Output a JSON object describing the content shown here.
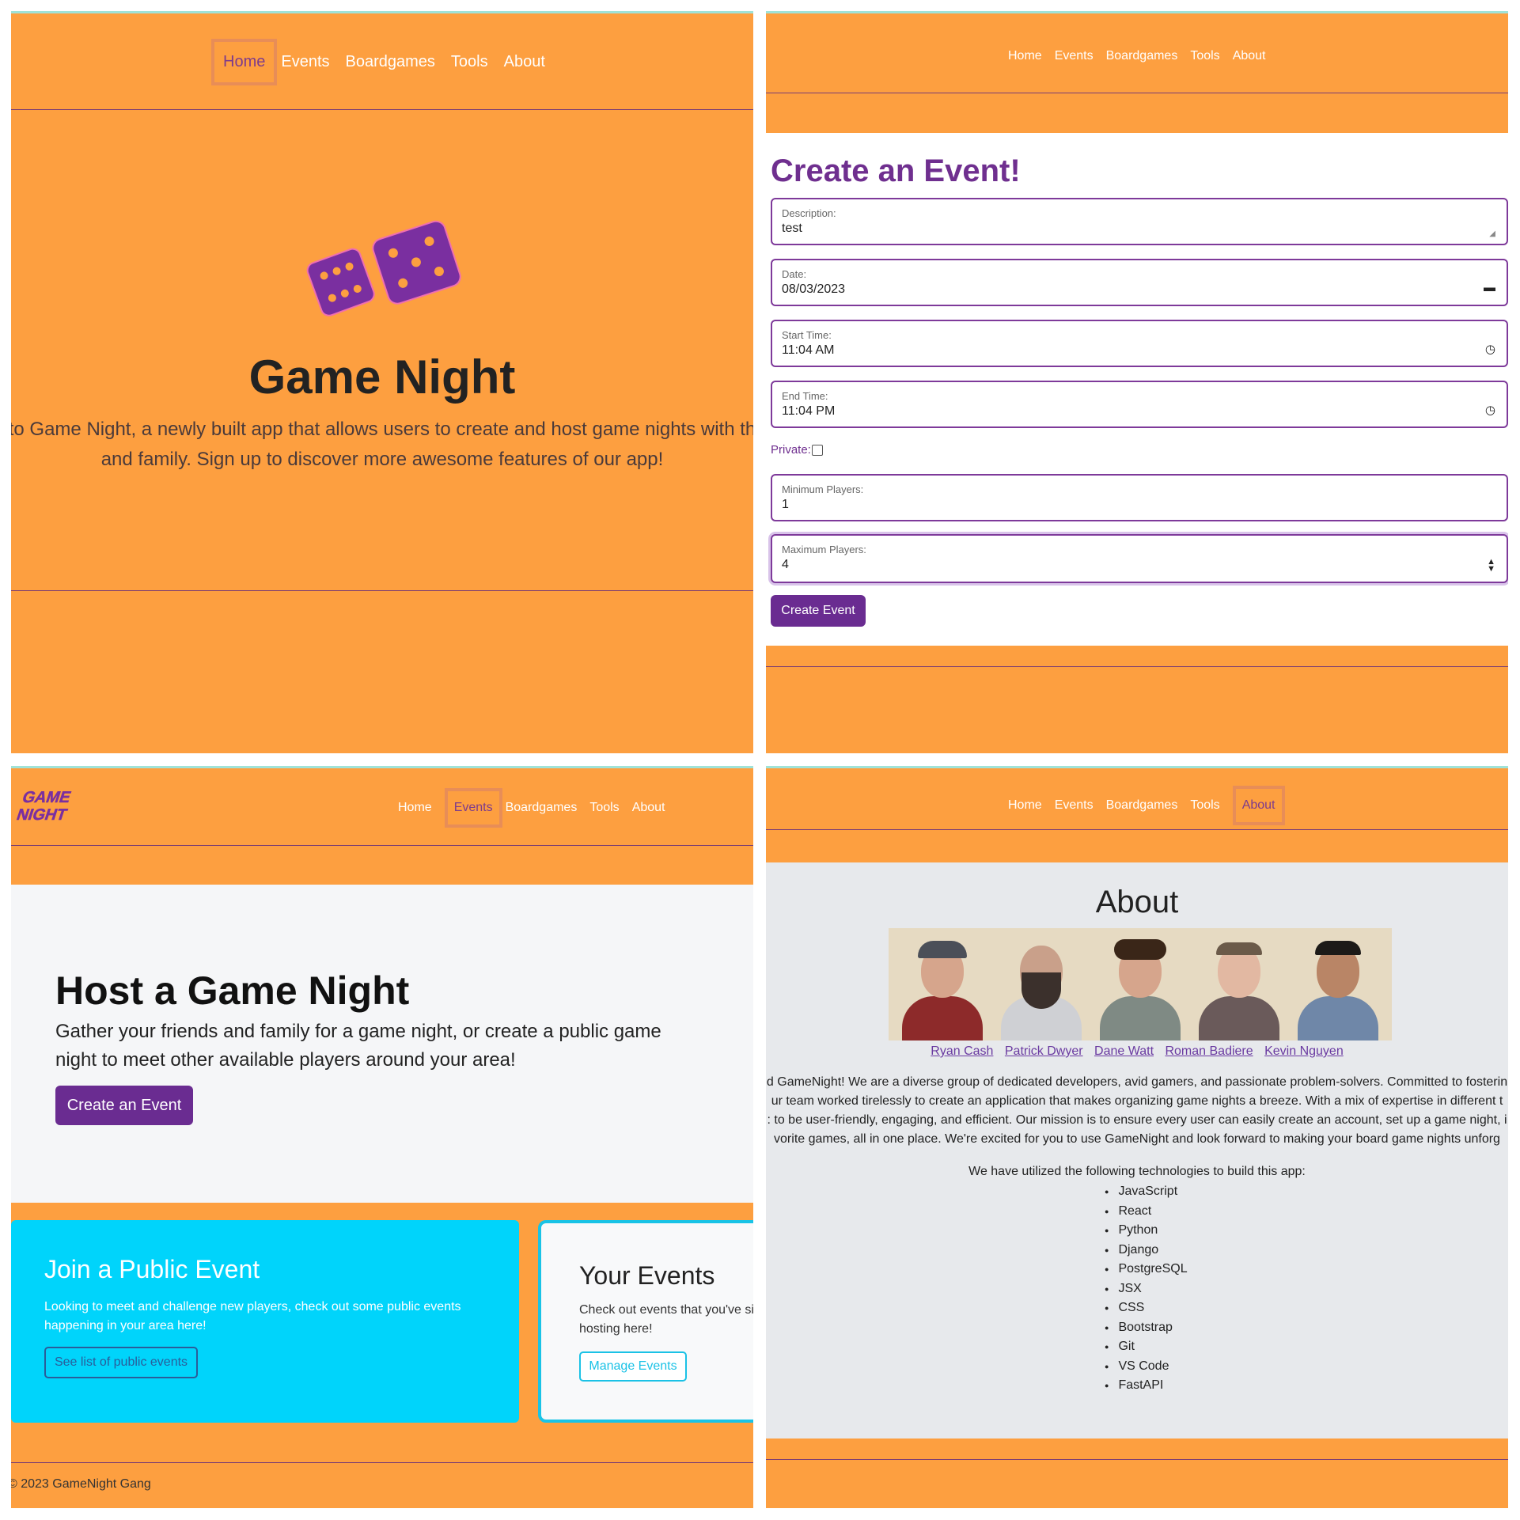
{
  "nav": [
    "Home",
    "Events",
    "Boardgames",
    "Tools",
    "About"
  ],
  "colors": {
    "orange": "#fd9f40",
    "purple": "#6a2c91",
    "cyan": "#00d4fb",
    "active_border": "#e88d57"
  },
  "home": {
    "active_nav": "Home",
    "title": "Game Night",
    "text_line1": "to Game Night, a newly built app that allows users to create and host game nights with th",
    "text_line2": "and family. Sign up to discover more awesome features of our app!",
    "icon": "dice-icon"
  },
  "create_event": {
    "title": "Create an Event!",
    "fields": [
      {
        "label": "Description:",
        "value": "test"
      },
      {
        "label": "Date:",
        "value": "08/03/2023",
        "icon": "calendar-icon"
      },
      {
        "label": "Start Time:",
        "value": "11:04 AM",
        "icon": "clock-icon"
      },
      {
        "label": "End Time:",
        "value": "11:04 PM",
        "icon": "clock-icon"
      }
    ],
    "private_label": "Private:",
    "private_checked": false,
    "min_players": {
      "label": "Minimum Players:",
      "value": "1"
    },
    "max_players": {
      "label": "Maximum Players:",
      "value": "4"
    },
    "submit_label": "Create Event"
  },
  "events": {
    "logo_text_1": "GAME",
    "logo_text_2": "NIGHT",
    "active_nav": "Events",
    "host_title": "Host a Game Night",
    "host_text": "Gather your friends and family for a game night, or create a public game night to meet other available players around your area!",
    "host_button": "Create an Event",
    "join_title": "Join a Public Event",
    "join_text": "Looking to meet and challenge new players, check out some public events happening in your area here!",
    "join_button": "See list of public events",
    "your_title": "Your Events",
    "your_text": "Check out events that you've si hosting here!",
    "your_button": "Manage Events",
    "footer": "© 2023 GameNight Gang"
  },
  "about": {
    "active_nav": "About",
    "title": "About",
    "team": [
      "Ryan Cash",
      "Patrick Dwyer",
      "Dane Watt",
      "Roman Badiere",
      "Kevin Nguyen"
    ],
    "paragraph": [
      "d GameNight! We are a diverse group of dedicated developers, avid gamers, and passionate problem-solvers. Committed to fosterin",
      "ur team worked tirelessly to create an application that makes organizing game nights a breeze. With a mix of expertise in different t",
      ": to be user-friendly, engaging, and efficient. Our mission is to ensure every user can easily create an account, set up a game night, i",
      "vorite games, all in one place. We're excited for you to use GameNight and look forward to making your board game nights unforg"
    ],
    "tech_intro": "We have utilized the following technologies to build this app:",
    "technologies": [
      "JavaScript",
      "React",
      "Python",
      "Django",
      "PostgreSQL",
      "JSX",
      "CSS",
      "Bootstrap",
      "Git",
      "VS Code",
      "FastAPI"
    ]
  }
}
